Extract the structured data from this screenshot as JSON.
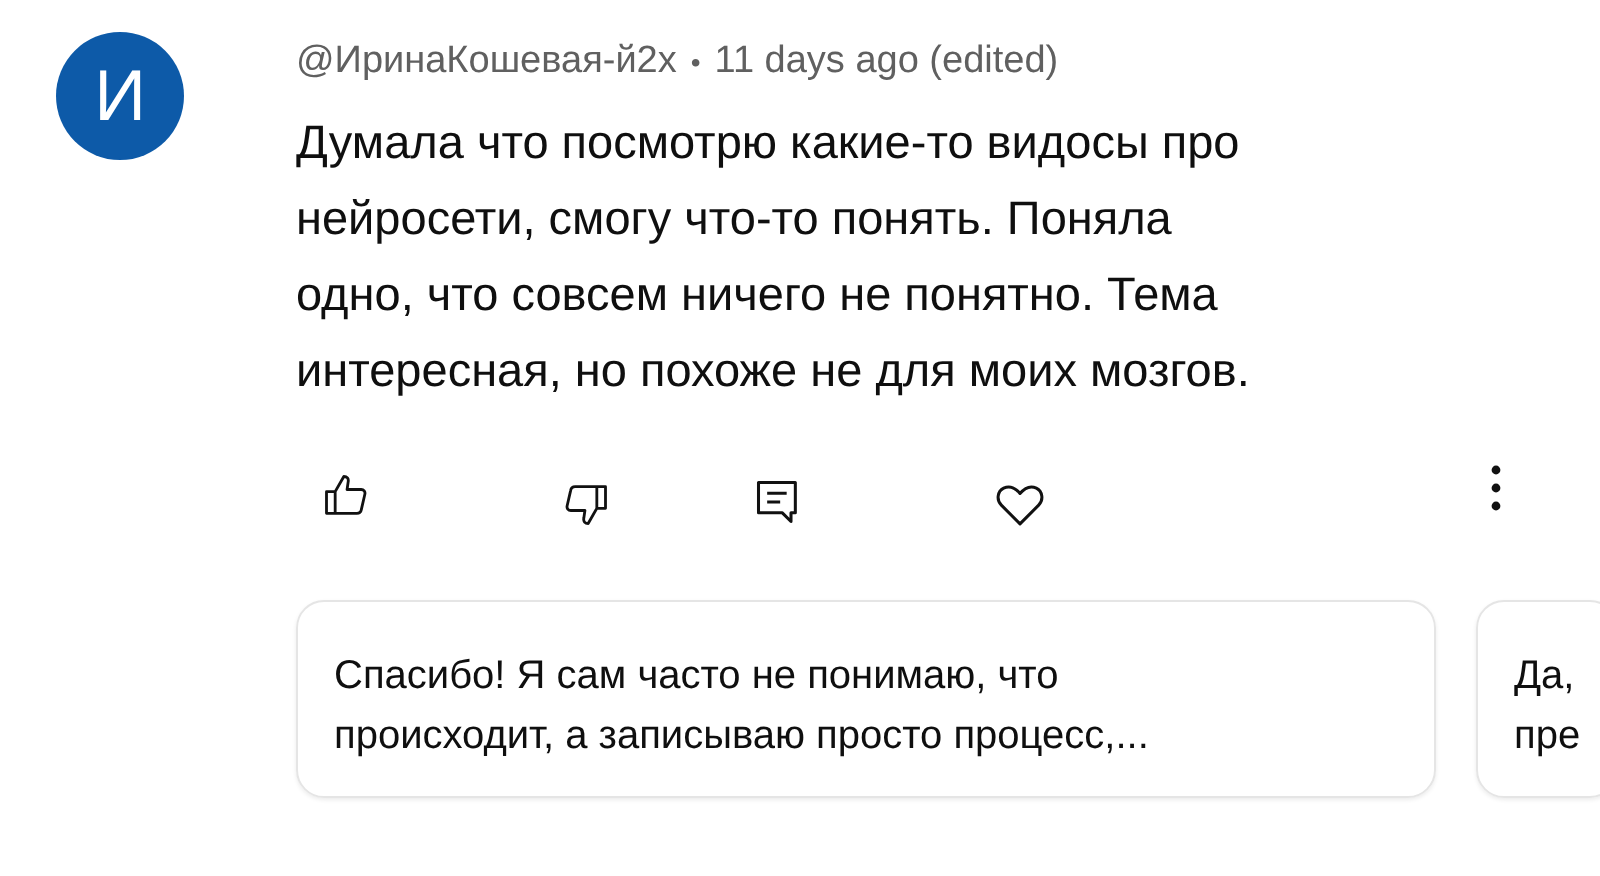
{
  "comment": {
    "avatar_letter": "И",
    "author": "@ИринаКошевая-й2х",
    "separator": "•",
    "time": "11 days ago (edited)",
    "text": "Думала что посмотрю какие-то видосы про\nнейросети, смогу что-то понять. Поняла\nодно, что совсем ничего не понятно. Тема\nинтересная, но похоже не для моих мозгов."
  },
  "actions": [
    {
      "kind": "like"
    },
    {
      "kind": "dislike"
    },
    {
      "kind": "reply"
    },
    {
      "kind": "heart"
    },
    {
      "kind": "more"
    }
  ],
  "suggested_replies": [
    {
      "text": "Спасибо! Я сам часто не понимаю, что\nпроисходит, а записываю просто процесс,..."
    },
    {
      "text": "Да,\nпре"
    }
  ]
}
